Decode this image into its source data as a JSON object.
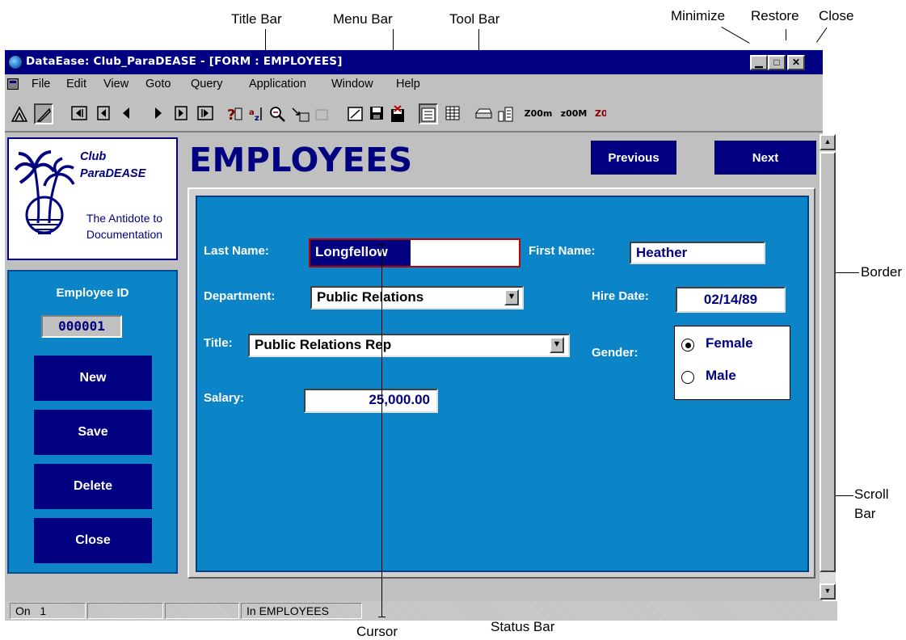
{
  "annotations": {
    "title_bar": "Title Bar",
    "menu_bar": "Menu Bar",
    "tool_bar": "Tool Bar",
    "minimize": "Minimize",
    "restore": "Restore",
    "close": "Close",
    "border": "Border",
    "scroll_bar_1": "Scroll",
    "scroll_bar_2": "Bar",
    "cursor": "Cursor",
    "status_bar": "Status Bar"
  },
  "window": {
    "title": "DataEase: Club_ParaDEASE - [FORM : EMPLOYEES]",
    "buttons": {
      "minimize": "▁",
      "restore": "□",
      "close": "✕"
    }
  },
  "menu": [
    "File",
    "Edit",
    "View",
    "Goto",
    "Query",
    "Application",
    "Window",
    "Help"
  ],
  "toolbar": {
    "zoom_out": "Z00m",
    "zoom_in": "z00M",
    "zoom_cut": "Z0"
  },
  "logo": {
    "club_line1": "Club",
    "club_line2": "ParaDEASE",
    "tagline_line1": "The Antidote to",
    "tagline_line2": "Documentation"
  },
  "form": {
    "title": "EMPLOYEES",
    "previous": "Previous",
    "next": "Next",
    "employee_id_label": "Employee ID",
    "employee_id": "000001",
    "last_name_label": "Last Name:",
    "last_name": "Longfellow",
    "first_name_label": "First Name:",
    "first_name": "Heather",
    "department_label": "Department:",
    "department": "Public Relations",
    "hire_date_label": "Hire Date:",
    "hire_date": "02/14/89",
    "title_label": "Title:",
    "job_title": "Public Relations Rep",
    "gender_label": "Gender:",
    "gender_options": [
      "Female",
      "Male"
    ],
    "gender_selected": "Female",
    "salary_label": "Salary:",
    "salary": "25,000.00"
  },
  "side_buttons": {
    "new": "New",
    "save": "Save",
    "delete": "Delete",
    "close": "Close"
  },
  "status": {
    "record": "On   1",
    "message": "In EMPLOYEES"
  },
  "colors": {
    "form_bg": "#0b84c8",
    "navy": "#000080",
    "chrome": "#c0c0c0"
  }
}
